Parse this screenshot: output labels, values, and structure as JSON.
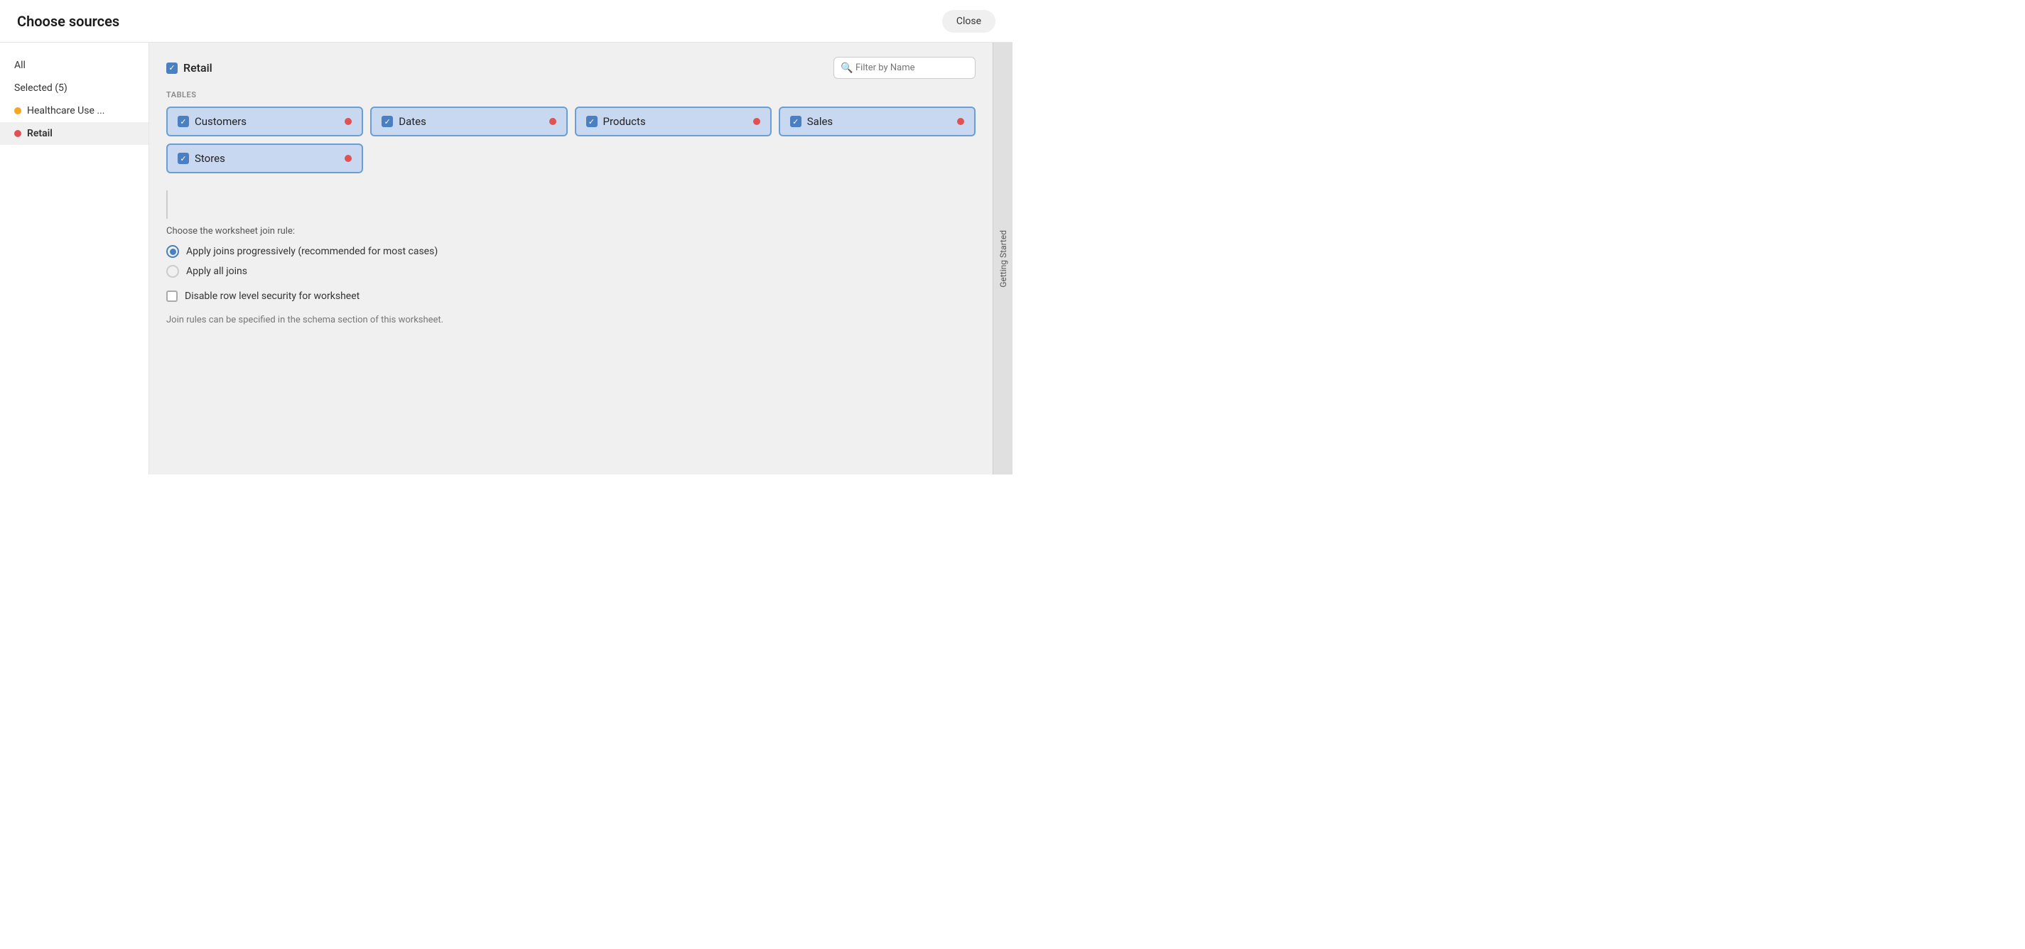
{
  "header": {
    "title": "Choose sources",
    "close_label": "Close"
  },
  "sidebar": {
    "all_label": "All",
    "selected_label": "Selected (5)",
    "items": [
      {
        "id": "healthcare",
        "label": "Healthcare Use ...",
        "dot_color": "orange"
      },
      {
        "id": "retail",
        "label": "Retail",
        "dot_color": "red",
        "active": true
      }
    ]
  },
  "main": {
    "source_name": "Retail",
    "filter_placeholder": "Filter by Name",
    "tables_label": "TABLES",
    "tables": [
      {
        "id": "customers",
        "label": "Customers",
        "checked": true
      },
      {
        "id": "dates",
        "label": "Dates",
        "checked": true
      },
      {
        "id": "products",
        "label": "Products",
        "checked": true
      },
      {
        "id": "sales",
        "label": "Sales",
        "checked": true
      },
      {
        "id": "stores",
        "label": "Stores",
        "checked": true
      }
    ],
    "join_rule_label": "Choose the worksheet join rule:",
    "radio_options": [
      {
        "id": "progressive",
        "label": "Apply joins progressively (recommended for most cases)",
        "selected": true
      },
      {
        "id": "all",
        "label": "Apply all joins",
        "selected": false
      }
    ],
    "checkbox_option": {
      "label": "Disable row level security for worksheet",
      "checked": false
    },
    "join_note": "Join rules can be specified in the schema section of this worksheet."
  },
  "getting_started": {
    "label": "Getting Started"
  }
}
